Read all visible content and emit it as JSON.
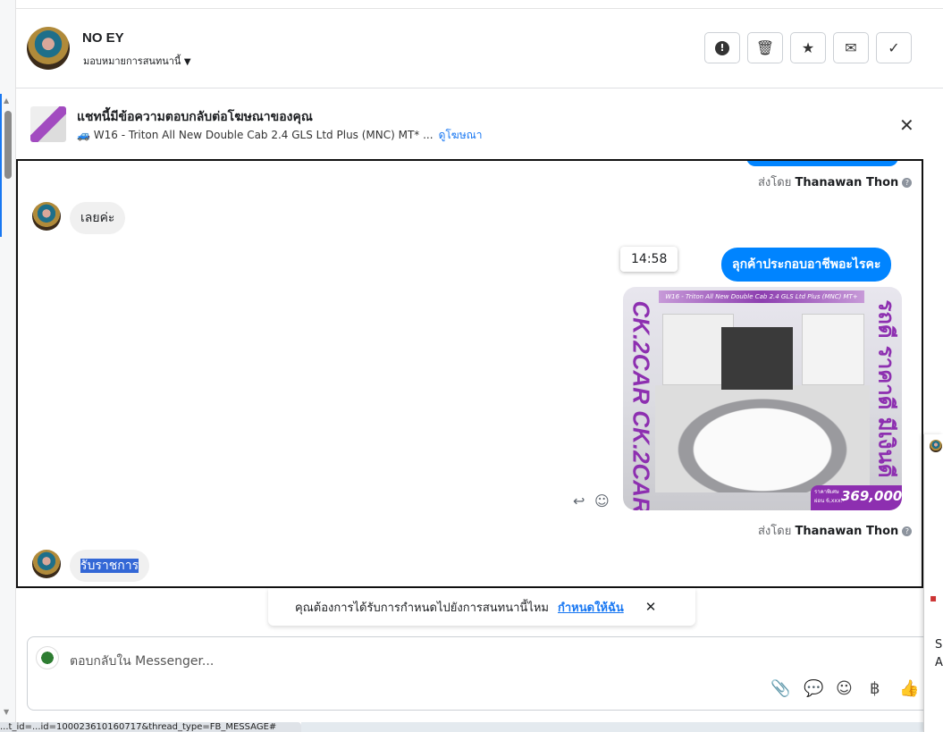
{
  "header": {
    "name": "NO EY",
    "assign_label": "มอบหมายการสนทนานี้"
  },
  "toolbar": [
    {
      "icon": "alert-icon",
      "glyph": "❗"
    },
    {
      "icon": "trash-icon",
      "glyph": "🗑"
    },
    {
      "icon": "star-icon",
      "glyph": "★"
    },
    {
      "icon": "mail-icon",
      "glyph": "✉"
    },
    {
      "icon": "check-icon",
      "glyph": "✓"
    }
  ],
  "ad": {
    "title": "แชทนี้มีข้อความตอบกลับต่อโฆษณาของคุณ",
    "subtitle": "W16 - Triton All New Double Cab 2.4 GLS Ltd Plus (MNC) MT* ...",
    "link": "ดูโฆษณา"
  },
  "messages": {
    "sent_by_prefix": "ส่งโดย",
    "sender": "Thanawan Thon",
    "in1": "เลยค่ะ",
    "out1": "ลุกค้าประกอบอาชีพอะไรคะ",
    "time": "14:58",
    "image": {
      "banner": "W16 - Triton All New Double Cab 2.4 GLS Ltd Plus (MNC) MT+",
      "left": "CK.2CAR CK.2CAR",
      "right": "รถดี ราคาดี มีเงินดี",
      "price_label": "ราคาพิเศษ",
      "price": "369,000.-",
      "installment": "ผ่อน 6,xxx.-"
    },
    "in2": "รับราชการ"
  },
  "suggestion": {
    "text": "คุณต้องการได้รับการกำหนดไปยังการสนทนานี้ไหม",
    "link": "กำหนดให้ฉัน"
  },
  "composer": {
    "placeholder": "ตอบกลับใน Messenger..."
  },
  "status_bar": "...t_id=...id=100023610160717&thread_type=FB_MESSAGE#"
}
